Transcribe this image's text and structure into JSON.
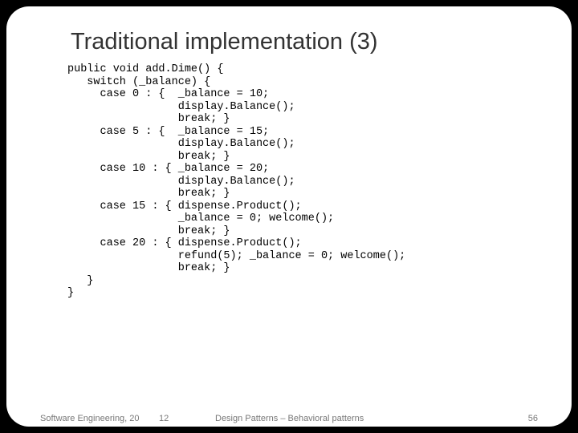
{
  "title": "Traditional implementation (3)",
  "code": "public void add.Dime() {\n   switch (_balance) {\n     case 0 : {  _balance = 10;\n                 display.Balance();\n                 break; }\n     case 5 : {  _balance = 15;\n                 display.Balance();\n                 break; }\n     case 10 : { _balance = 20;\n                 display.Balance();\n                 break; }\n     case 15 : { dispense.Product();\n                 _balance = 0; welcome();\n                 break; }\n     case 20 : { dispense.Product();\n                 refund(5); _balance = 0; welcome();\n                 break; }\n   }\n}",
  "footer": {
    "left": "Software Engineering, 20",
    "center1": "12",
    "center2": "Design Patterns – Behavioral patterns",
    "right": "56"
  }
}
